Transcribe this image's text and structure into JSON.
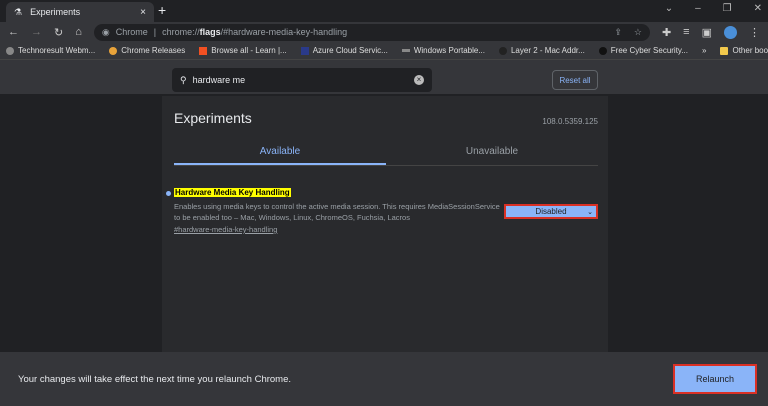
{
  "tab": {
    "title": "Experiments",
    "close": "×",
    "new": "+"
  },
  "window": {
    "dropdown": "⌄",
    "minimize": "–",
    "maximize": "❐",
    "close": "✕"
  },
  "omnibox": {
    "site": "Chrome",
    "prefix": "chrome://",
    "bold": "flags",
    "suffix": "/#hardware-media-key-handling"
  },
  "bookmarks": [
    "Technoresult Webm...",
    "Chrome Releases",
    "Browse all - Learn |...",
    "Azure Cloud Servic...",
    "Windows Portable...",
    "Layer 2 - Mac Addr...",
    "Free Cyber Security..."
  ],
  "bookmarks_more": "»",
  "other_bookmarks": "Other bookmarks",
  "search": {
    "value": "hardware me",
    "reset": "Reset all"
  },
  "page": {
    "title": "Experiments",
    "version": "108.0.5359.125",
    "tabs": [
      "Available",
      "Unavailable"
    ]
  },
  "flag": {
    "name": "Hardware Media Key Handling",
    "description": "Enables using media keys to control the active media session. This requires MediaSessionService to be enabled too – Mac, Windows, Linux, ChromeOS, Fuchsia, Lacros",
    "link": "#hardware-media-key-handling",
    "value": "Disabled"
  },
  "relaunch": {
    "message": "Your changes will take effect the next time you relaunch Chrome.",
    "button": "Relaunch"
  }
}
